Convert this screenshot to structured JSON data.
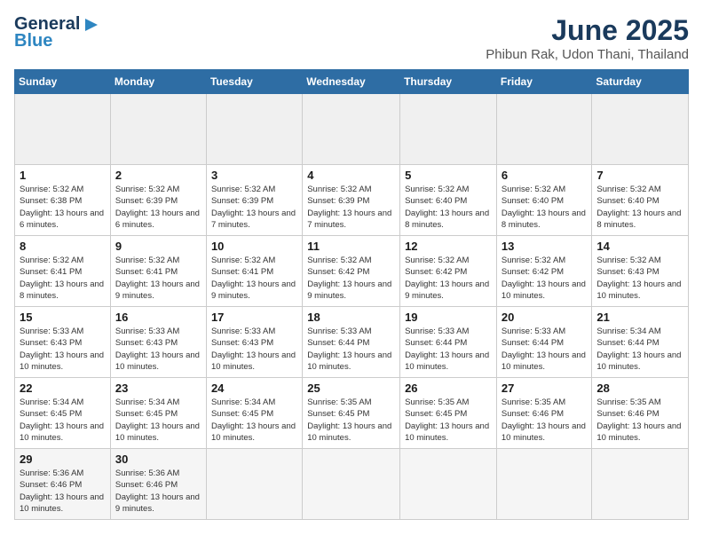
{
  "header": {
    "logo_general": "General",
    "logo_blue": "Blue",
    "month_title": "June 2025",
    "location": "Phibun Rak, Udon Thani, Thailand"
  },
  "calendar": {
    "days_of_week": [
      "Sunday",
      "Monday",
      "Tuesday",
      "Wednesday",
      "Thursday",
      "Friday",
      "Saturday"
    ],
    "weeks": [
      [
        {
          "day": "",
          "empty": true
        },
        {
          "day": "",
          "empty": true
        },
        {
          "day": "",
          "empty": true
        },
        {
          "day": "",
          "empty": true
        },
        {
          "day": "",
          "empty": true
        },
        {
          "day": "",
          "empty": true
        },
        {
          "day": "",
          "empty": true
        }
      ],
      [
        {
          "day": "1",
          "sunrise": "5:32 AM",
          "sunset": "6:38 PM",
          "daylight": "13 hours and 6 minutes."
        },
        {
          "day": "2",
          "sunrise": "5:32 AM",
          "sunset": "6:39 PM",
          "daylight": "13 hours and 6 minutes."
        },
        {
          "day": "3",
          "sunrise": "5:32 AM",
          "sunset": "6:39 PM",
          "daylight": "13 hours and 7 minutes."
        },
        {
          "day": "4",
          "sunrise": "5:32 AM",
          "sunset": "6:39 PM",
          "daylight": "13 hours and 7 minutes."
        },
        {
          "day": "5",
          "sunrise": "5:32 AM",
          "sunset": "6:40 PM",
          "daylight": "13 hours and 8 minutes."
        },
        {
          "day": "6",
          "sunrise": "5:32 AM",
          "sunset": "6:40 PM",
          "daylight": "13 hours and 8 minutes."
        },
        {
          "day": "7",
          "sunrise": "5:32 AM",
          "sunset": "6:40 PM",
          "daylight": "13 hours and 8 minutes."
        }
      ],
      [
        {
          "day": "8",
          "sunrise": "5:32 AM",
          "sunset": "6:41 PM",
          "daylight": "13 hours and 8 minutes."
        },
        {
          "day": "9",
          "sunrise": "5:32 AM",
          "sunset": "6:41 PM",
          "daylight": "13 hours and 9 minutes."
        },
        {
          "day": "10",
          "sunrise": "5:32 AM",
          "sunset": "6:41 PM",
          "daylight": "13 hours and 9 minutes."
        },
        {
          "day": "11",
          "sunrise": "5:32 AM",
          "sunset": "6:42 PM",
          "daylight": "13 hours and 9 minutes."
        },
        {
          "day": "12",
          "sunrise": "5:32 AM",
          "sunset": "6:42 PM",
          "daylight": "13 hours and 9 minutes."
        },
        {
          "day": "13",
          "sunrise": "5:32 AM",
          "sunset": "6:42 PM",
          "daylight": "13 hours and 10 minutes."
        },
        {
          "day": "14",
          "sunrise": "5:32 AM",
          "sunset": "6:43 PM",
          "daylight": "13 hours and 10 minutes."
        }
      ],
      [
        {
          "day": "15",
          "sunrise": "5:33 AM",
          "sunset": "6:43 PM",
          "daylight": "13 hours and 10 minutes."
        },
        {
          "day": "16",
          "sunrise": "5:33 AM",
          "sunset": "6:43 PM",
          "daylight": "13 hours and 10 minutes."
        },
        {
          "day": "17",
          "sunrise": "5:33 AM",
          "sunset": "6:43 PM",
          "daylight": "13 hours and 10 minutes."
        },
        {
          "day": "18",
          "sunrise": "5:33 AM",
          "sunset": "6:44 PM",
          "daylight": "13 hours and 10 minutes."
        },
        {
          "day": "19",
          "sunrise": "5:33 AM",
          "sunset": "6:44 PM",
          "daylight": "13 hours and 10 minutes."
        },
        {
          "day": "20",
          "sunrise": "5:33 AM",
          "sunset": "6:44 PM",
          "daylight": "13 hours and 10 minutes."
        },
        {
          "day": "21",
          "sunrise": "5:34 AM",
          "sunset": "6:44 PM",
          "daylight": "13 hours and 10 minutes."
        }
      ],
      [
        {
          "day": "22",
          "sunrise": "5:34 AM",
          "sunset": "6:45 PM",
          "daylight": "13 hours and 10 minutes."
        },
        {
          "day": "23",
          "sunrise": "5:34 AM",
          "sunset": "6:45 PM",
          "daylight": "13 hours and 10 minutes."
        },
        {
          "day": "24",
          "sunrise": "5:34 AM",
          "sunset": "6:45 PM",
          "daylight": "13 hours and 10 minutes."
        },
        {
          "day": "25",
          "sunrise": "5:35 AM",
          "sunset": "6:45 PM",
          "daylight": "13 hours and 10 minutes."
        },
        {
          "day": "26",
          "sunrise": "5:35 AM",
          "sunset": "6:45 PM",
          "daylight": "13 hours and 10 minutes."
        },
        {
          "day": "27",
          "sunrise": "5:35 AM",
          "sunset": "6:46 PM",
          "daylight": "13 hours and 10 minutes."
        },
        {
          "day": "28",
          "sunrise": "5:35 AM",
          "sunset": "6:46 PM",
          "daylight": "13 hours and 10 minutes."
        }
      ],
      [
        {
          "day": "29",
          "sunrise": "5:36 AM",
          "sunset": "6:46 PM",
          "daylight": "13 hours and 10 minutes."
        },
        {
          "day": "30",
          "sunrise": "5:36 AM",
          "sunset": "6:46 PM",
          "daylight": "13 hours and 9 minutes."
        },
        {
          "day": "",
          "empty": true
        },
        {
          "day": "",
          "empty": true
        },
        {
          "day": "",
          "empty": true
        },
        {
          "day": "",
          "empty": true
        },
        {
          "day": "",
          "empty": true
        }
      ]
    ]
  }
}
